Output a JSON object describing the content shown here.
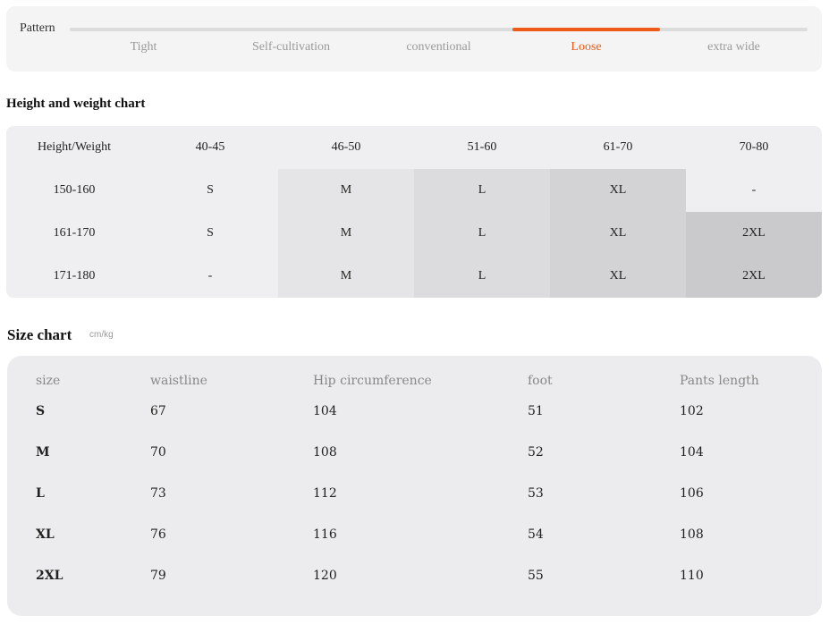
{
  "pattern": {
    "label": "Pattern",
    "options": [
      "Tight",
      "Self-cultivation",
      "conventional",
      "Loose",
      "extra wide"
    ],
    "selected": "Loose",
    "accent_color": "#ef5b16"
  },
  "height_weight": {
    "title": "Height and weight chart",
    "header": [
      "Height/Weight",
      "40-45",
      "46-50",
      "51-60",
      "61-70",
      "70-80"
    ],
    "rows": [
      [
        "150-160",
        "S",
        "M",
        "L",
        "XL",
        "-"
      ],
      [
        "161-170",
        "S",
        "M",
        "L",
        "XL",
        "2XL"
      ],
      [
        "171-180",
        "-",
        "M",
        "L",
        "XL",
        "2XL"
      ]
    ]
  },
  "size_chart": {
    "title": "Size chart",
    "unit": "cm/kg",
    "header": [
      "size",
      "waistline",
      "Hip circumference",
      "foot",
      "Pants length"
    ],
    "rows": [
      [
        "S",
        "67",
        "104",
        "51",
        "102"
      ],
      [
        "M",
        "70",
        "108",
        "52",
        "104"
      ],
      [
        "L",
        "73",
        "112",
        "53",
        "106"
      ],
      [
        "XL",
        "76",
        "116",
        "54",
        "108"
      ],
      [
        "2XL",
        "79",
        "120",
        "55",
        "110"
      ]
    ]
  }
}
